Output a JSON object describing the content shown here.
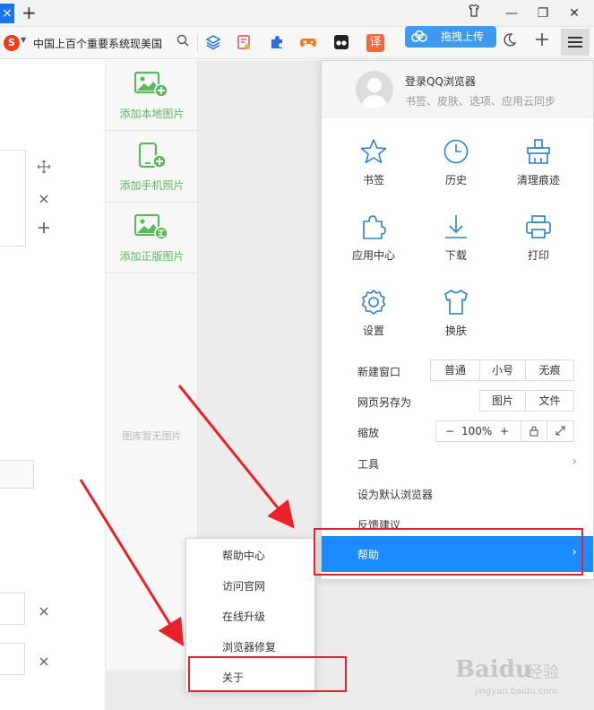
{
  "tabbar": {
    "tab_close": "×",
    "new_tab": "+",
    "window_controls": [
      "⌂",
      "—",
      "❐",
      "✕"
    ]
  },
  "toolbar": {
    "address_text": "中国上百个重要系统现美国",
    "upload_label": "拖拽上传",
    "ext_translate": "译"
  },
  "image_panel": {
    "items": [
      {
        "label": "添加本地图片",
        "icon": "image-add-icon"
      },
      {
        "label": "添加手机照片",
        "icon": "phone-add-icon"
      },
      {
        "label": "添加正版图片",
        "icon": "image-licensed-icon"
      }
    ],
    "empty_text": "图库暂无图片"
  },
  "menu": {
    "login_title": "登录QQ浏览器",
    "login_subtitle": "书签、皮肤、选项、应用云同步",
    "grid": [
      {
        "label": "书签",
        "icon": "star-icon"
      },
      {
        "label": "历史",
        "icon": "clock-icon"
      },
      {
        "label": "清理痕迹",
        "icon": "broom-icon"
      },
      {
        "label": "应用中心",
        "icon": "puzzle-icon"
      },
      {
        "label": "下载",
        "icon": "download-icon"
      },
      {
        "label": "打印",
        "icon": "printer-icon"
      },
      {
        "label": "设置",
        "icon": "gear-icon"
      },
      {
        "label": "换肤",
        "icon": "tshirt-icon"
      }
    ],
    "new_window": {
      "label": "新建窗口",
      "options": [
        "普通",
        "小号",
        "无痕"
      ]
    },
    "save_page": {
      "label": "网页另存为",
      "options": [
        "图片",
        "文件"
      ]
    },
    "zoom": {
      "label": "缩放",
      "minus": "−",
      "value": "100%",
      "plus": "+"
    },
    "tools": "工具",
    "set_default": "设为默认浏览器",
    "feedback": "反馈建议",
    "help": "帮助"
  },
  "submenu": {
    "items": [
      "帮助中心",
      "访问官网",
      "在线升级",
      "浏览器修复",
      "关于"
    ]
  },
  "watermark": {
    "brand": "Baidu",
    "suffix": "经验",
    "url": "jingyan.baidu.com"
  },
  "colors": {
    "accent": "#1a8cff",
    "annotation": "#e8212a",
    "green": "#5cb85c"
  }
}
